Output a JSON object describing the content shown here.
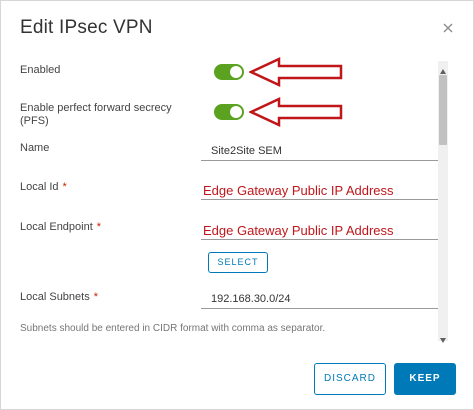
{
  "dialog": {
    "title": "Edit IPsec VPN"
  },
  "form": {
    "enabled_label": "Enabled",
    "pfs_label_line1": "Enable perfect forward secrecy",
    "pfs_label_line2": "(PFS)",
    "name_label": "Name",
    "name_value": "Site2Site SEM",
    "local_id_label": "Local Id",
    "local_endpoint_label": "Local Endpoint",
    "required_marker": "*",
    "select_button": "SELECT",
    "local_subnets_label": "Local Subnets",
    "local_subnets_value": "192.168.30.0/24",
    "hint": "Subnets should be entered in CIDR format with comma as separator."
  },
  "annotations": {
    "local_id_overlay": "Edge Gateway Public IP Address",
    "local_endpoint_overlay": "Edge Gateway Public IP Address"
  },
  "toggles": {
    "enabled_on": true,
    "pfs_on": true
  },
  "footer": {
    "discard": "DISCARD",
    "keep": "KEEP"
  },
  "colors": {
    "toggle_on": "#5aa220",
    "primary": "#0079b8",
    "annotation": "#c0161a",
    "required": "#c92100"
  },
  "icons": {
    "close": "close-icon",
    "scroll_up": "scroll-up-arrow-icon",
    "scroll_down": "scroll-down-arrow-icon",
    "annotation_arrow": "red-arrow-icon"
  }
}
